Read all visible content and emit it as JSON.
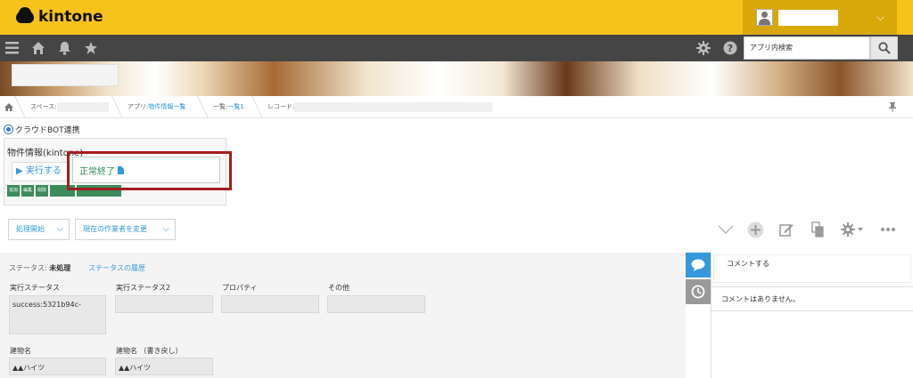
{
  "header": {
    "logo_text": "kintone",
    "user_chevron": "⌵"
  },
  "navbar": {
    "search_placeholder": "アプリ内検索"
  },
  "breadcrumb": {
    "space_label": "スペース:",
    "app_label": "アプリ:",
    "app_value": "物件情報一覧",
    "list_label": "一覧:",
    "list_value": "一覧1",
    "record_label": "レコード:"
  },
  "plugin": {
    "title": "クラウドBOT連携",
    "panel_label": "物件情報(kintone)",
    "run_button": "▶ 実行する",
    "status_text": "正常終了",
    "mini_buttons": [
      "追加",
      "編集",
      "削除"
    ]
  },
  "process": {
    "start_button": "処理開始",
    "change_assignee_button": "現在の作業者を変更"
  },
  "record": {
    "status_prefix": "ステータス:",
    "status_value": "未処理",
    "history_link": "ステータスの履歴",
    "fields": [
      {
        "label": "実行ステータス",
        "value": "success:5321b94c-"
      },
      {
        "label": "実行ステータス2",
        "value": ""
      },
      {
        "label": "プロパティ",
        "value": ""
      },
      {
        "label": "その他",
        "value": ""
      },
      {
        "label": "建物名",
        "value": "▲▲ハイツ"
      },
      {
        "label": "建物名 （書き戻し）",
        "value": "▲▲ハイツ"
      }
    ]
  },
  "comments": {
    "input_placeholder": "コメントする",
    "empty_text": "コメントはありません。"
  },
  "colors": {
    "header_yellow": "#f6c31c",
    "navbar_dark": "#454545",
    "link_blue": "#3498db",
    "success_green": "#2e8b57",
    "highlight_red": "#a31e22"
  }
}
